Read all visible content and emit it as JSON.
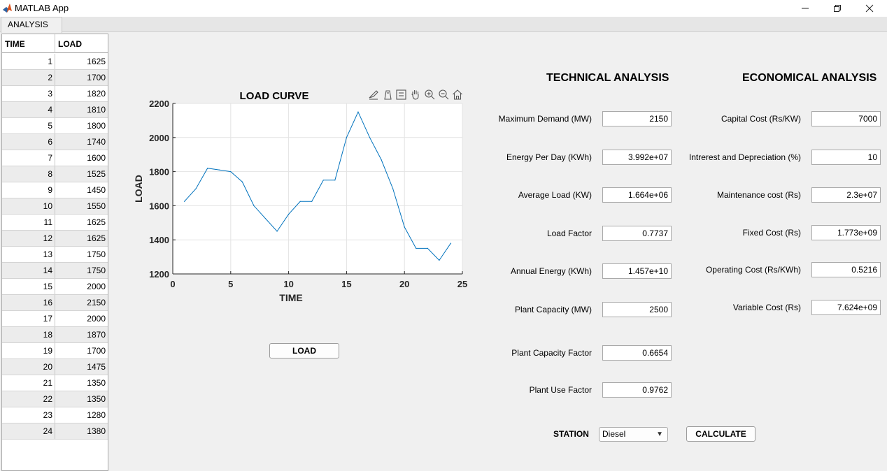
{
  "window": {
    "title": "MATLAB App"
  },
  "tabs": [
    {
      "label": "ANALYSIS"
    }
  ],
  "table": {
    "columns": [
      "TIME",
      "LOAD"
    ],
    "rows": [
      [
        1,
        1625
      ],
      [
        2,
        1700
      ],
      [
        3,
        1820
      ],
      [
        4,
        1810
      ],
      [
        5,
        1800
      ],
      [
        6,
        1740
      ],
      [
        7,
        1600
      ],
      [
        8,
        1525
      ],
      [
        9,
        1450
      ],
      [
        10,
        1550
      ],
      [
        11,
        1625
      ],
      [
        12,
        1625
      ],
      [
        13,
        1750
      ],
      [
        14,
        1750
      ],
      [
        15,
        2000
      ],
      [
        16,
        2150
      ],
      [
        17,
        2000
      ],
      [
        18,
        1870
      ],
      [
        19,
        1700
      ],
      [
        20,
        1475
      ],
      [
        21,
        1350
      ],
      [
        22,
        1350
      ],
      [
        23,
        1280
      ],
      [
        24,
        1380
      ]
    ]
  },
  "chart_data": {
    "type": "line",
    "title": "LOAD CURVE",
    "xlabel": "TIME",
    "ylabel": "LOAD",
    "xlim": [
      0,
      25
    ],
    "ylim": [
      1200,
      2200
    ],
    "xticks": [
      0,
      5,
      10,
      15,
      20,
      25
    ],
    "yticks": [
      1200,
      1400,
      1600,
      1800,
      2000,
      2200
    ],
    "grid": true,
    "color": "#0072bd",
    "series": [
      {
        "x": [
          1,
          2,
          3,
          4,
          5,
          6,
          7,
          8,
          9,
          10,
          11,
          12,
          13,
          14,
          15,
          16,
          17,
          18,
          19,
          20,
          21,
          22,
          23,
          24
        ],
        "values": [
          1625,
          1700,
          1820,
          1810,
          1800,
          1740,
          1600,
          1525,
          1450,
          1550,
          1625,
          1625,
          1750,
          1750,
          2000,
          2150,
          2000,
          1870,
          1700,
          1475,
          1350,
          1350,
          1280,
          1380
        ]
      }
    ]
  },
  "chart_toolbar": [
    "brush-icon",
    "data-tips-icon",
    "legend-icon",
    "pan-icon",
    "zoom-in-icon",
    "zoom-out-icon",
    "home-icon"
  ],
  "buttons": {
    "load": "LOAD",
    "calculate": "CALCULATE"
  },
  "technical": {
    "heading": "TECHNICAL ANALYSIS",
    "fields": [
      {
        "label": "Maximum Demand (MW)",
        "value": "2150"
      },
      {
        "label": "Energy Per Day (KWh)",
        "value": "3.992e+07"
      },
      {
        "label": "Average Load (KW)",
        "value": "1.664e+06"
      },
      {
        "label": "Load Factor",
        "value": "0.7737"
      },
      {
        "label": "Annual Energy (KWh)",
        "value": "1.457e+10"
      },
      {
        "label": "Plant Capacity (MW)",
        "value": "2500"
      },
      {
        "label": "Plant Capacity Factor",
        "value": "0.6654"
      },
      {
        "label": "Plant Use Factor",
        "value": "0.9762"
      }
    ]
  },
  "economical": {
    "heading": "ECONOMICAL ANALYSIS",
    "fields": [
      {
        "label": "Capital Cost (Rs/KW)",
        "value": "7000"
      },
      {
        "label": "Intrerest and Depreciation (%)",
        "value": "10"
      },
      {
        "label": "Maintenance cost (Rs)",
        "value": "2.3e+07"
      },
      {
        "label": "Fixed Cost (Rs)",
        "value": "1.773e+09"
      },
      {
        "label": "Operating Cost (Rs/KWh)",
        "value": "0.5216"
      },
      {
        "label": "Variable Cost (Rs)",
        "value": "7.624e+09"
      }
    ]
  },
  "station": {
    "label": "STATION",
    "selected": "Diesel"
  }
}
